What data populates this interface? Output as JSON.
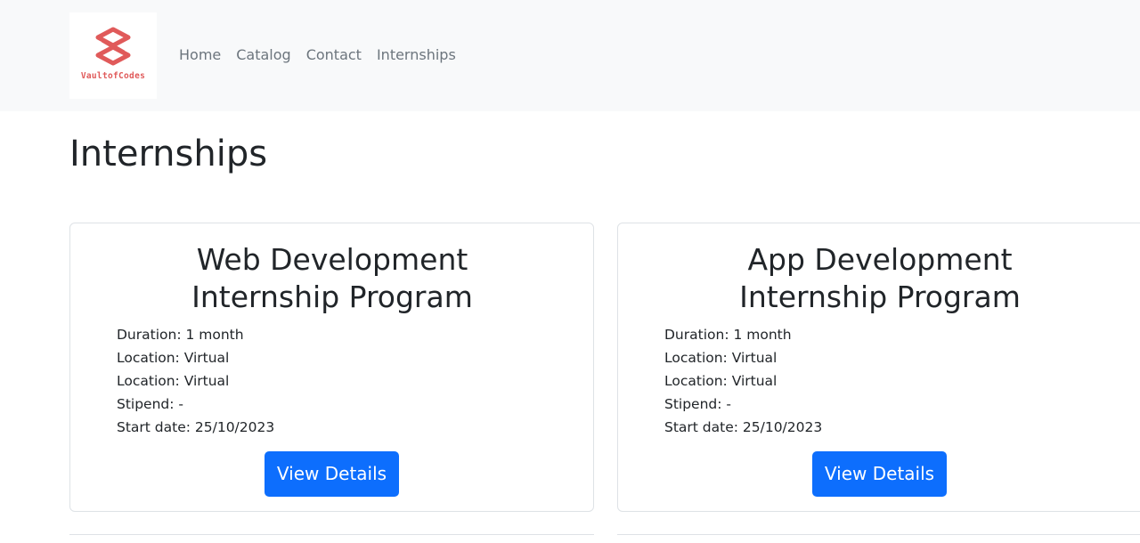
{
  "brand": {
    "name": "VaultofCodes",
    "logo_icon": "vault-cube-logo",
    "logo_color": "#e05a5a"
  },
  "nav": {
    "items": [
      {
        "label": "Home"
      },
      {
        "label": "Catalog"
      },
      {
        "label": "Contact"
      },
      {
        "label": "Internships"
      }
    ]
  },
  "page": {
    "title": "Internships"
  },
  "cards": [
    {
      "title": "Web Development Internship Program",
      "details": [
        "Duration: 1 month",
        "Location: Virtual",
        "Location: Virtual",
        "Stipend: -",
        "Start date: 25/10/2023"
      ],
      "button_label": "View Details"
    },
    {
      "title": "App Development Internship Program",
      "details": [
        "Duration: 1 month",
        "Location: Virtual",
        "Location: Virtual",
        "Stipend: -",
        "Start date: 25/10/2023"
      ],
      "button_label": "View Details"
    }
  ],
  "colors": {
    "navbar_bg": "#f8f9fa",
    "primary_button": "#0d6efd",
    "nav_link": "#6c757d",
    "text": "#212529"
  }
}
